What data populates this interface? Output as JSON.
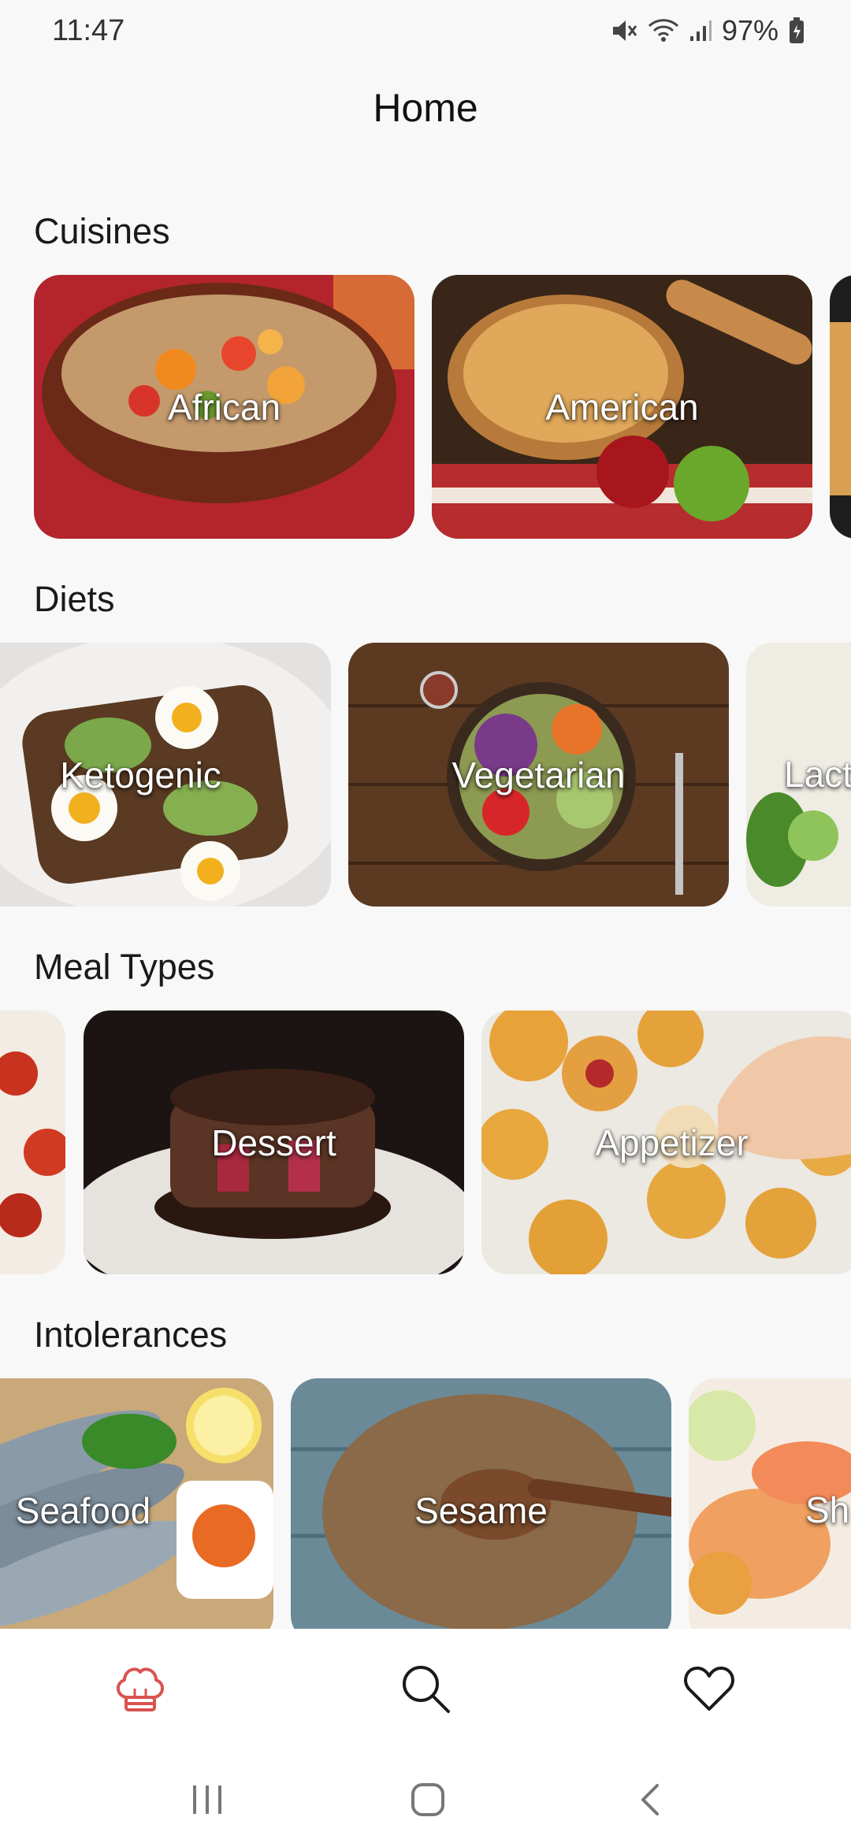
{
  "status": {
    "time": "11:47",
    "battery": "97%"
  },
  "header": {
    "title": "Home"
  },
  "sections": [
    {
      "title": "Cuisines",
      "cards": [
        "African",
        "American"
      ]
    },
    {
      "title": "Diets",
      "cards": [
        "Ketogenic",
        "Vegetarian",
        "Lact"
      ]
    },
    {
      "title": "Meal Types",
      "cards": [
        "Dessert",
        "Appetizer"
      ]
    },
    {
      "title": "Intolerances",
      "cards": [
        "Seafood",
        "Sesame",
        "Sh"
      ]
    }
  ],
  "nav": {
    "items": [
      "chef-hat-icon",
      "search-icon",
      "heart-icon"
    ],
    "active_color": "#d9534f"
  }
}
